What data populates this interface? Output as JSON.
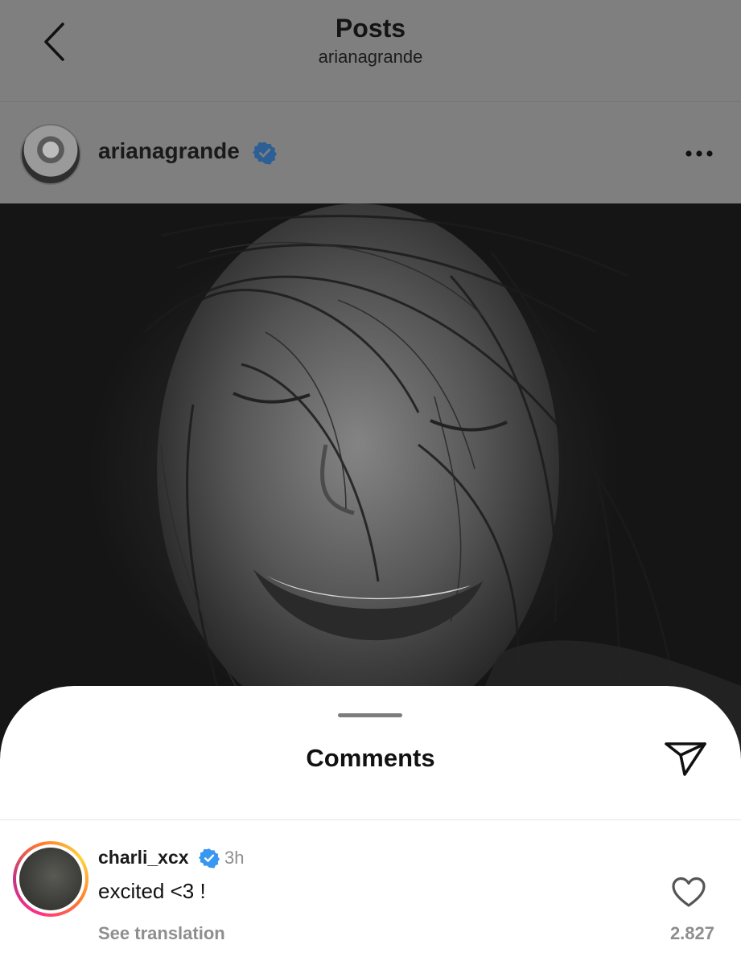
{
  "header": {
    "title": "Posts",
    "subtitle": "arianagrande",
    "back_icon": "chevron-left-icon"
  },
  "post": {
    "username": "arianagrande",
    "verified": true,
    "verified_color": "#3897f0",
    "more_icon": "more-horizontal-icon",
    "image_description_color": "#1e1e1e"
  },
  "comments_sheet": {
    "title": "Comments",
    "share_icon": "paper-plane-icon",
    "comments": [
      {
        "username": "charli_xcx",
        "verified": true,
        "time": "3h",
        "text": "excited <3 !",
        "translate_label": "See translation",
        "like_count": "2.827",
        "like_icon": "heart-outline-icon"
      }
    ]
  },
  "colors": {
    "dim_overlay": "#7f7f7f",
    "sheet_bg": "#ffffff",
    "secondary_text": "#8e8e8e",
    "story_ring_start": "#ff2f86",
    "story_ring_end": "#ffd43b"
  }
}
